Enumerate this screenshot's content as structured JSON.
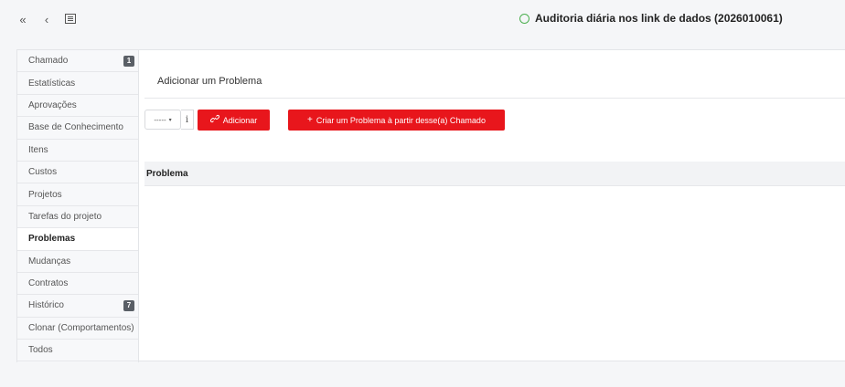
{
  "header": {
    "title": "Auditoria diária nos link de dados (2026010061)",
    "status_color": "#4caf50",
    "nav_icons": [
      "double-chevron-left-icon",
      "chevron-left-icon",
      "list-icon"
    ]
  },
  "sidebar": {
    "items": [
      {
        "label": "Chamado",
        "badge": "1"
      },
      {
        "label": "Estatísticas"
      },
      {
        "label": "Aprovações"
      },
      {
        "label": "Base de Conhecimento"
      },
      {
        "label": "Itens"
      },
      {
        "label": "Custos"
      },
      {
        "label": "Projetos"
      },
      {
        "label": "Tarefas do projeto"
      },
      {
        "label": "Problemas",
        "active": true
      },
      {
        "label": "Mudanças"
      },
      {
        "label": "Contratos"
      },
      {
        "label": "Histórico",
        "badge": "7"
      },
      {
        "label": "Clonar (Comportamentos)"
      },
      {
        "label": "Todos"
      }
    ]
  },
  "main": {
    "section_title": "Adicionar um Problema",
    "select_value": "-----",
    "info_label": "i",
    "add_button": "Adicionar",
    "create_button": "Criar um Problema à partir desse(a) Chamado",
    "table_header": "Problema",
    "accent_color": "#e8161c"
  }
}
